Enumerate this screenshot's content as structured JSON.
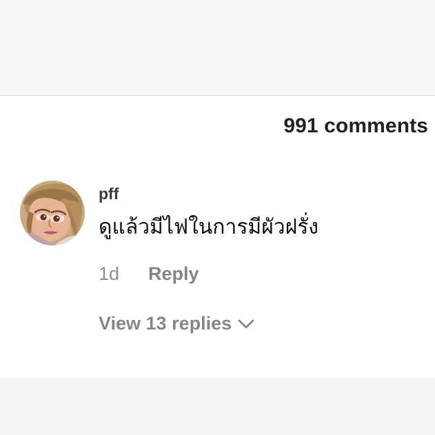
{
  "header": {
    "comments_count_label": "991 comments"
  },
  "comment": {
    "username": "pff",
    "text": "ดูแล้วมีไฟในการมีผัวฝรั่ง",
    "timestamp": "1d",
    "reply_label": "Reply",
    "view_replies_label": "View 13 replies",
    "avatar_description_icon": "user-avatar"
  },
  "icons": {
    "view_replies_indicator": "chevron-down-icon"
  }
}
